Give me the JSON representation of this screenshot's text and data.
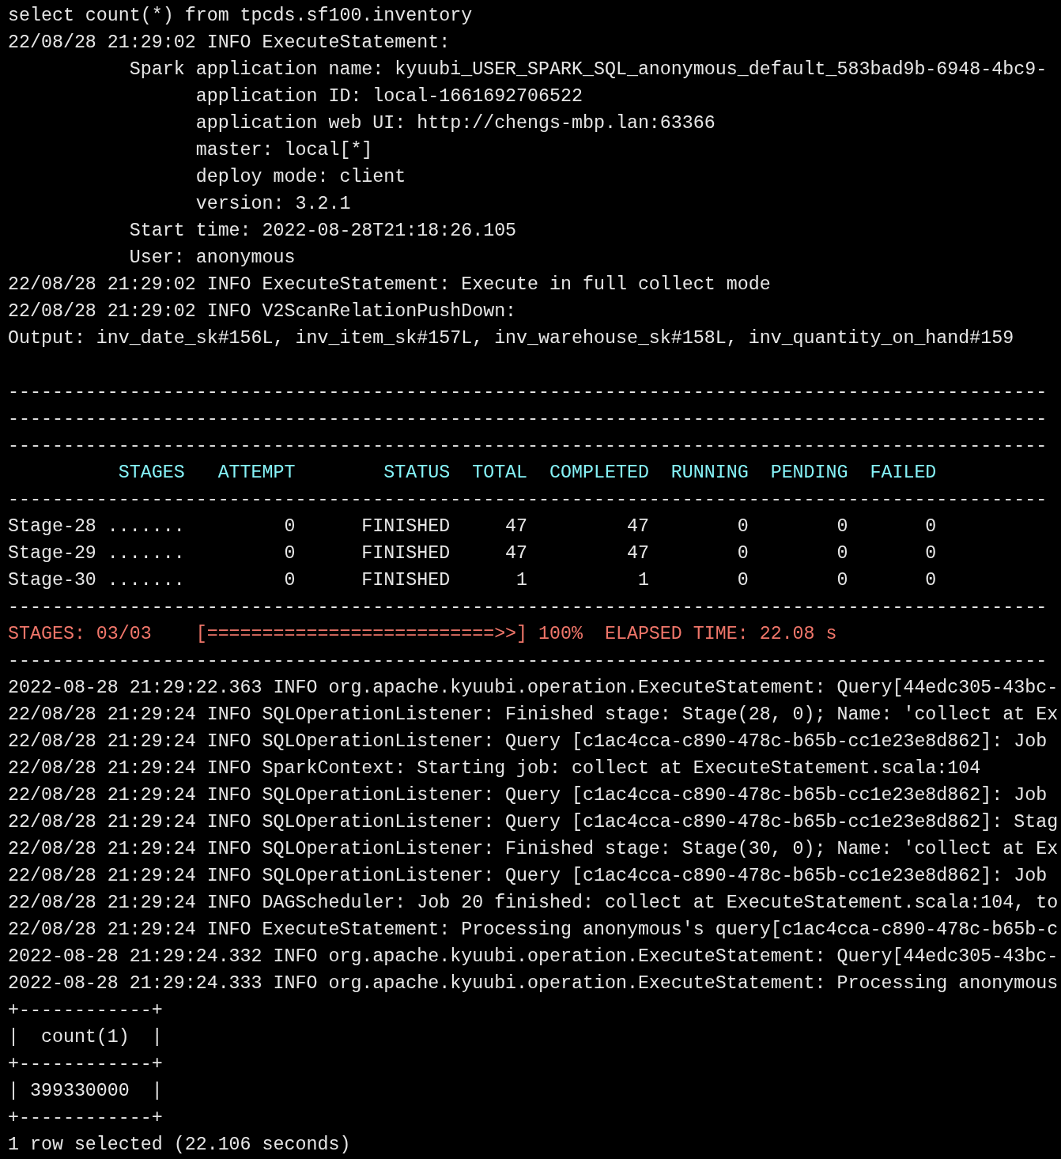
{
  "terminal": {
    "lines": [
      {
        "kind": "log",
        "text": "select count(*) from tpcds.sf100.inventory"
      },
      {
        "kind": "log",
        "text": "22/08/28 21:29:02 INFO ExecuteStatement:"
      },
      {
        "kind": "log",
        "text": "           Spark application name: kyuubi_USER_SPARK_SQL_anonymous_default_583bad9b-6948-4bc9-"
      },
      {
        "kind": "log",
        "text": "                 application ID: local-1661692706522"
      },
      {
        "kind": "log",
        "text": "                 application web UI: http://chengs-mbp.lan:63366"
      },
      {
        "kind": "log",
        "text": "                 master: local[*]"
      },
      {
        "kind": "log",
        "text": "                 deploy mode: client"
      },
      {
        "kind": "log",
        "text": "                 version: 3.2.1"
      },
      {
        "kind": "log",
        "text": "           Start time: 2022-08-28T21:18:26.105"
      },
      {
        "kind": "log",
        "text": "           User: anonymous"
      },
      {
        "kind": "log",
        "text": "22/08/28 21:29:02 INFO ExecuteStatement: Execute in full collect mode"
      },
      {
        "kind": "log",
        "text": "22/08/28 21:29:02 INFO V2ScanRelationPushDown:"
      },
      {
        "kind": "log",
        "text": "Output: inv_date_sk#156L, inv_item_sk#157L, inv_warehouse_sk#158L, inv_quantity_on_hand#159"
      },
      {
        "kind": "blank"
      },
      {
        "kind": "rule",
        "text": "----------------------------------------------------------------------------------------------"
      },
      {
        "kind": "rule",
        "text": "----------------------------------------------------------------------------------------------"
      },
      {
        "kind": "rule",
        "text": "----------------------------------------------------------------------------------------------"
      },
      {
        "kind": "header",
        "text": "          STAGES   ATTEMPT        STATUS  TOTAL  COMPLETED  RUNNING  PENDING  FAILED"
      },
      {
        "kind": "rule",
        "text": "----------------------------------------------------------------------------------------------"
      },
      {
        "kind": "stage",
        "text": "Stage-28 .......         0      FINISHED     47         47        0        0       0"
      },
      {
        "kind": "stage",
        "text": "Stage-29 .......         0      FINISHED     47         47        0        0       0"
      },
      {
        "kind": "stage",
        "text": "Stage-30 .......         0      FINISHED      1          1        0        0       0"
      },
      {
        "kind": "rule",
        "text": "----------------------------------------------------------------------------------------------"
      },
      {
        "kind": "progress",
        "text": "STAGES: 03/03    [==========================>>] 100%  ELAPSED TIME: 22.08 s"
      },
      {
        "kind": "rule",
        "text": "----------------------------------------------------------------------------------------------"
      },
      {
        "kind": "log",
        "text": "2022-08-28 21:29:22.363 INFO org.apache.kyuubi.operation.ExecuteStatement: Query[44edc305-43bc-"
      },
      {
        "kind": "log",
        "text": "22/08/28 21:29:24 INFO SQLOperationListener: Finished stage: Stage(28, 0); Name: 'collect at Ex"
      },
      {
        "kind": "log",
        "text": "22/08/28 21:29:24 INFO SQLOperationListener: Query [c1ac4cca-c890-478c-b65b-cc1e23e8d862]: Job"
      },
      {
        "kind": "log",
        "text": "22/08/28 21:29:24 INFO SparkContext: Starting job: collect at ExecuteStatement.scala:104"
      },
      {
        "kind": "log",
        "text": "22/08/28 21:29:24 INFO SQLOperationListener: Query [c1ac4cca-c890-478c-b65b-cc1e23e8d862]: Job"
      },
      {
        "kind": "log",
        "text": "22/08/28 21:29:24 INFO SQLOperationListener: Query [c1ac4cca-c890-478c-b65b-cc1e23e8d862]: Stag"
      },
      {
        "kind": "log",
        "text": "22/08/28 21:29:24 INFO SQLOperationListener: Finished stage: Stage(30, 0); Name: 'collect at Ex"
      },
      {
        "kind": "log",
        "text": "22/08/28 21:29:24 INFO SQLOperationListener: Query [c1ac4cca-c890-478c-b65b-cc1e23e8d862]: Job"
      },
      {
        "kind": "log",
        "text": "22/08/28 21:29:24 INFO DAGScheduler: Job 20 finished: collect at ExecuteStatement.scala:104, to"
      },
      {
        "kind": "log",
        "text": "22/08/28 21:29:24 INFO ExecuteStatement: Processing anonymous's query[c1ac4cca-c890-478c-b65b-c"
      },
      {
        "kind": "log",
        "text": "2022-08-28 21:29:24.332 INFO org.apache.kyuubi.operation.ExecuteStatement: Query[44edc305-43bc-"
      },
      {
        "kind": "log",
        "text": "2022-08-28 21:29:24.333 INFO org.apache.kyuubi.operation.ExecuteStatement: Processing anonymous"
      },
      {
        "kind": "result",
        "text": "+------------+"
      },
      {
        "kind": "result",
        "text": "|  count(1)  |"
      },
      {
        "kind": "result",
        "text": "+------------+"
      },
      {
        "kind": "result",
        "text": "| 399330000  |"
      },
      {
        "kind": "result",
        "text": "+------------+"
      },
      {
        "kind": "log",
        "text": "1 row selected (22.106 seconds)"
      }
    ]
  }
}
